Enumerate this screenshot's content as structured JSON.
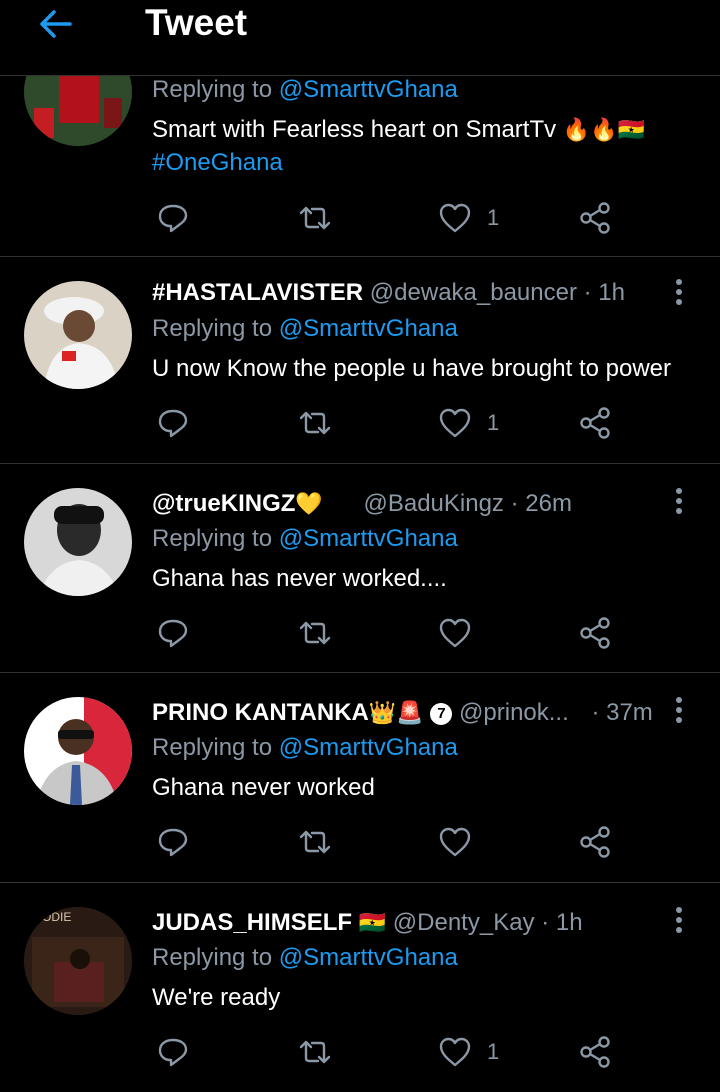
{
  "header": {
    "title": "Tweet"
  },
  "colors": {
    "accent": "#1d9bf0",
    "muted": "#8b98a5",
    "background": "#000000"
  },
  "tweets": [
    {
      "replying_prefix": "Replying to",
      "replying_handle": "@SmarttvGhana",
      "text": "Smart with Fearless heart on SmartTv",
      "emojis": "🔥🔥🇬🇭",
      "hashtag": "#OneGhana",
      "likes": "1"
    },
    {
      "name": "#HASTALAVISTER",
      "handle": "@dewaka_bauncer",
      "time": "· 1h",
      "replying_prefix": "Replying to",
      "replying_handle": "@SmarttvGhana",
      "text": "U now Know the people u have brought to power",
      "likes": "1"
    },
    {
      "name": "@trueKINGZ",
      "name_emoji": "💛",
      "handle": "@BaduKingz",
      "time": "· 26m",
      "replying_prefix": "Replying to",
      "replying_handle": "@SmarttvGhana",
      "text": "Ghana has never worked....",
      "likes": ""
    },
    {
      "name": "PRINO KANTANKA",
      "name_emoji": "👑🚨",
      "badge": "7",
      "handle": "@prinok...",
      "time": "· 37m",
      "replying_prefix": "Replying to",
      "replying_handle": "@SmarttvGhana",
      "text": "Ghana never worked",
      "likes": ""
    },
    {
      "name": "JUDAS_HIMSELF",
      "name_emoji": "🇬🇭",
      "handle": "@Denty_Kay",
      "time": "· 1h",
      "replying_prefix": "Replying to",
      "replying_handle": "@SmarttvGhana",
      "text": "We're ready",
      "avatar_text": "KODIE",
      "likes": "1"
    }
  ]
}
